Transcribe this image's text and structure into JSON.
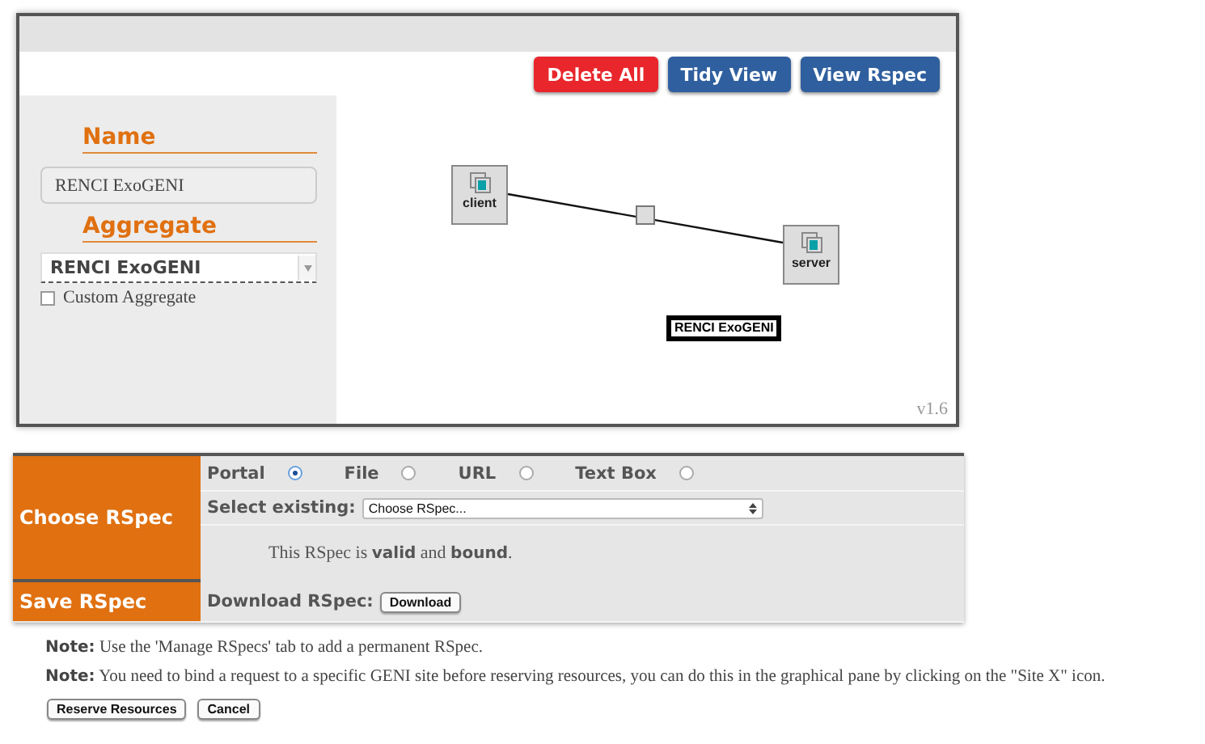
{
  "toolbar": {
    "buttons": [
      {
        "label": "Delete All",
        "kind": "danger"
      },
      {
        "label": "Tidy View",
        "kind": "primary"
      },
      {
        "label": "View Rspec",
        "kind": "primary"
      }
    ]
  },
  "side_panel": {
    "name_heading": "Name",
    "name_value": "RENCI ExoGENI",
    "aggregate_heading": "Aggregate",
    "aggregate_value": "RENCI ExoGENI",
    "custom_aggregate": {
      "label": "Custom Aggregate",
      "checked": false
    }
  },
  "canvas": {
    "nodes": [
      {
        "label": "client"
      },
      {
        "label": "server"
      }
    ],
    "site_label": "RENCI ExoGENI",
    "version": "v1.6"
  },
  "choose_rspec": {
    "heading": "Choose RSpec",
    "sources": [
      {
        "label": "Portal",
        "selected": true
      },
      {
        "label": "File",
        "selected": false
      },
      {
        "label": "URL",
        "selected": false
      },
      {
        "label": "Text Box",
        "selected": false
      }
    ],
    "select_label": "Select existing:",
    "select_value": "Choose RSpec...",
    "status": "This RSpec is **valid** and **bound**."
  },
  "save_rspec": {
    "heading": "Save RSpec",
    "download_label": "Download RSpec:",
    "download_button": "Download"
  },
  "notes": [
    {
      "label": "Note:",
      "text": "Use the 'Manage RSpecs' tab to add a permanent RSpec."
    },
    {
      "label": "Note:",
      "text": "You need to bind a request to a specific GENI site before reserving resources, you can do this in the graphical pane by clicking on the \"Site X\" icon."
    }
  ],
  "actions": [
    "Reserve Resources",
    "Cancel"
  ]
}
